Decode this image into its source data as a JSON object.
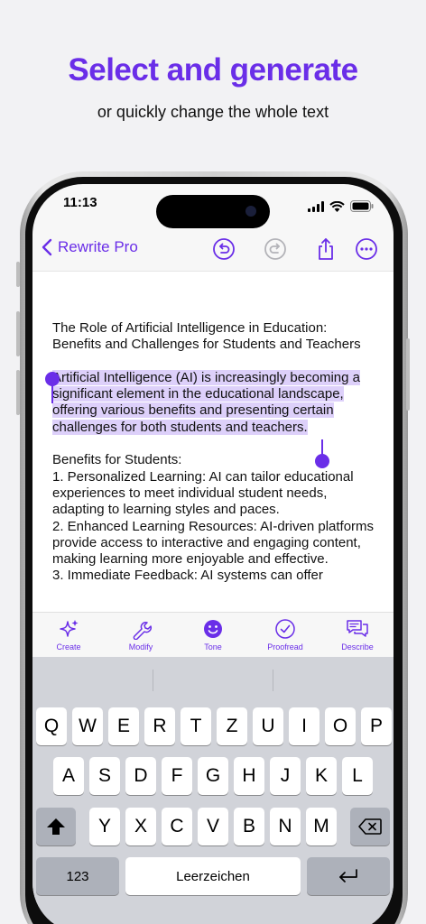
{
  "promo": {
    "headline": "Select and generate",
    "subline": "or quickly change the whole text"
  },
  "status_bar": {
    "time": "11:13",
    "icons": [
      "cellular-signal-icon",
      "wifi-icon",
      "battery-icon"
    ]
  },
  "nav": {
    "back_label": "Rewrite Pro",
    "actions": [
      "undo-icon",
      "redo-icon",
      "share-icon",
      "more-icon"
    ]
  },
  "document": {
    "title": "The Role of Artificial Intelligence in Education: Benefits and Challenges for Students and Teachers",
    "selected_paragraph": "Artificial Intelligence (AI) is increasingly becoming a significant element in the educational landscape, offering various benefits and presenting certain challenges for both students and teachers.",
    "section_heading": "Benefits for Students:",
    "items": [
      "1. Personalized Learning: AI can tailor educational experiences to meet individual student needs, adapting to learning styles and paces.",
      "2. Enhanced Learning Resources: AI-driven platforms provide access to interactive and engaging content, making learning more enjoyable and effective.",
      "3. Immediate Feedback: AI systems can offer"
    ]
  },
  "toolbar": {
    "create": "Create",
    "modify": "Modify",
    "tone": "Tone",
    "proofread": "Proofread",
    "describe": "Describe"
  },
  "keyboard": {
    "row1": [
      "Q",
      "W",
      "E",
      "R",
      "T",
      "Z",
      "U",
      "I",
      "O",
      "P"
    ],
    "row2": [
      "A",
      "S",
      "D",
      "F",
      "G",
      "H",
      "J",
      "K",
      "L"
    ],
    "row3": [
      "Y",
      "X",
      "C",
      "V",
      "B",
      "N",
      "M"
    ],
    "numbers_key": "123",
    "space_key": "Leerzeichen"
  },
  "colors": {
    "accent": "#6a2ee8",
    "selection": "#ddd0fa",
    "keyboard_bg": "#d1d3d9"
  }
}
